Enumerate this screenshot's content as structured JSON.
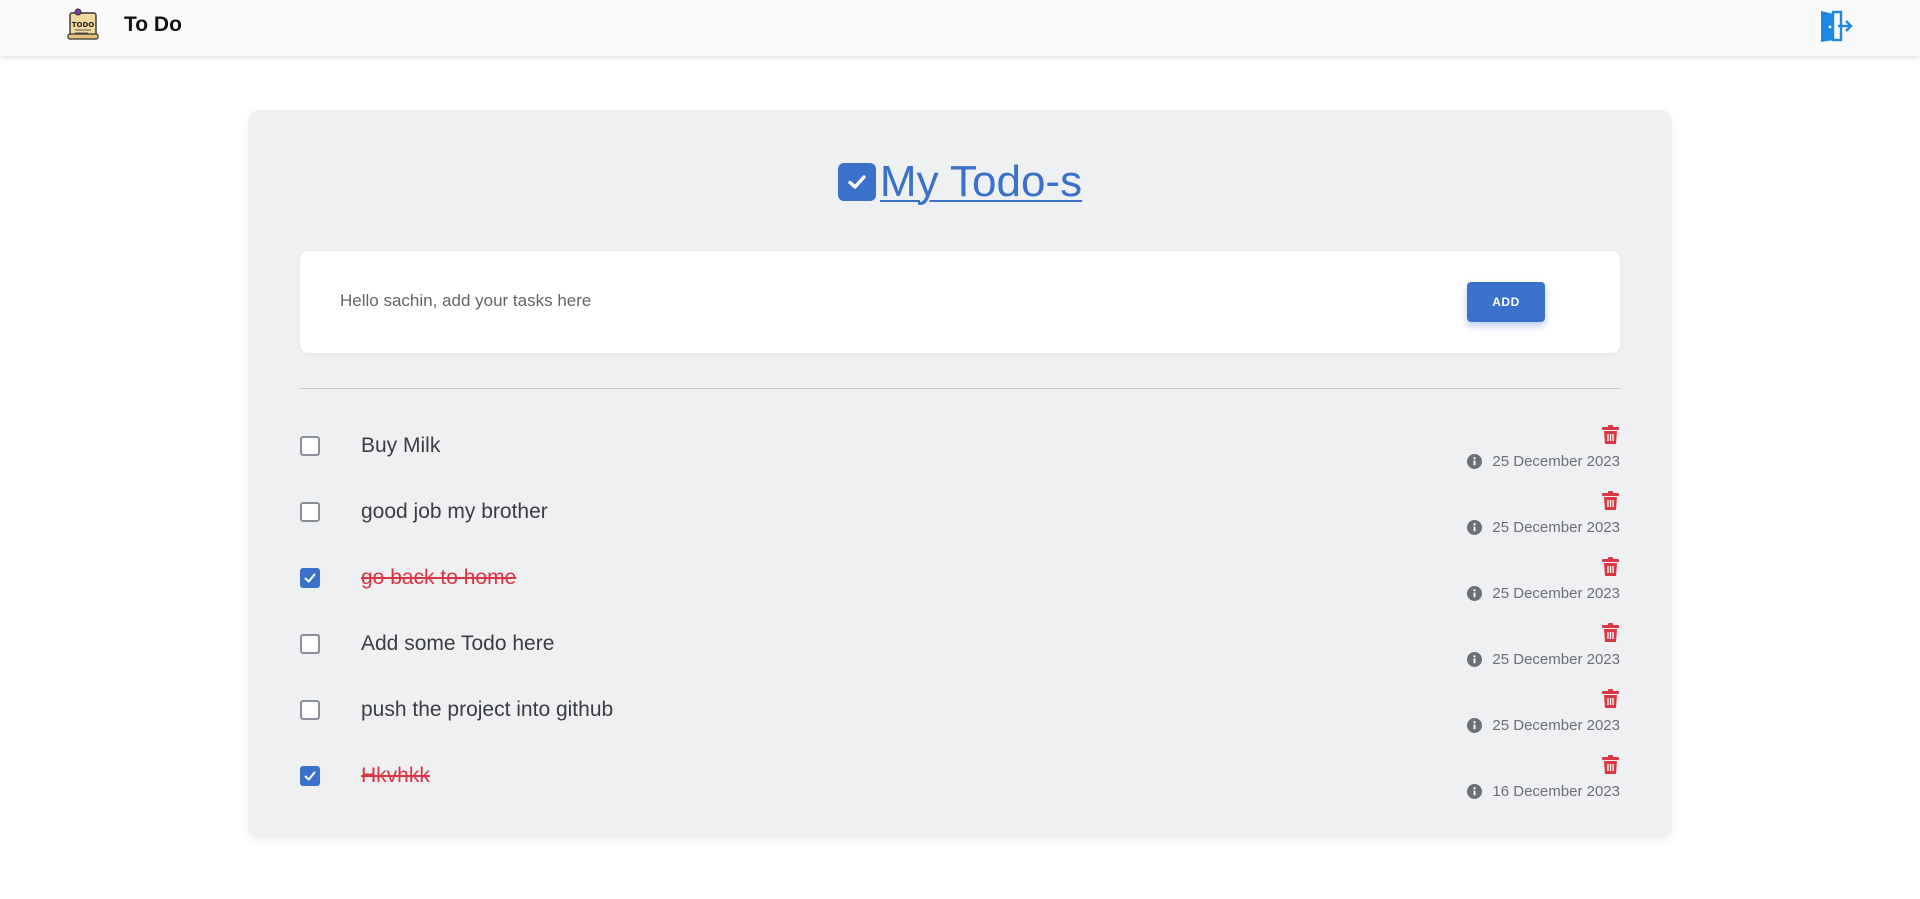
{
  "header": {
    "brand_name": "To Do",
    "logo_icon": "todo-note-logo-icon",
    "logout_icon": "exit-door-icon",
    "accent_color": "#1e88e5"
  },
  "main": {
    "title": "My Todo-s",
    "title_icon": "checkbox-checked-icon",
    "accent_color": "#3b71ca",
    "input": {
      "placeholder": "Hello sachin, add your tasks here",
      "value": ""
    },
    "add_label": "ADD"
  },
  "todos": [
    {
      "text": "Buy Milk",
      "date": "25 December 2023",
      "done": false
    },
    {
      "text": "good job my brother",
      "date": "25 December 2023",
      "done": false
    },
    {
      "text": "go back to home",
      "date": "25 December 2023",
      "done": true
    },
    {
      "text": "Add some Todo here",
      "date": "25 December 2023",
      "done": false
    },
    {
      "text": "push the project into github",
      "date": "25 December 2023",
      "done": false
    },
    {
      "text": "Hkvhkk",
      "date": "16 December 2023",
      "done": true
    }
  ],
  "colors": {
    "done_text": "#dc3545",
    "trash": "#dc3545",
    "card_bg": "#eff0f2"
  }
}
